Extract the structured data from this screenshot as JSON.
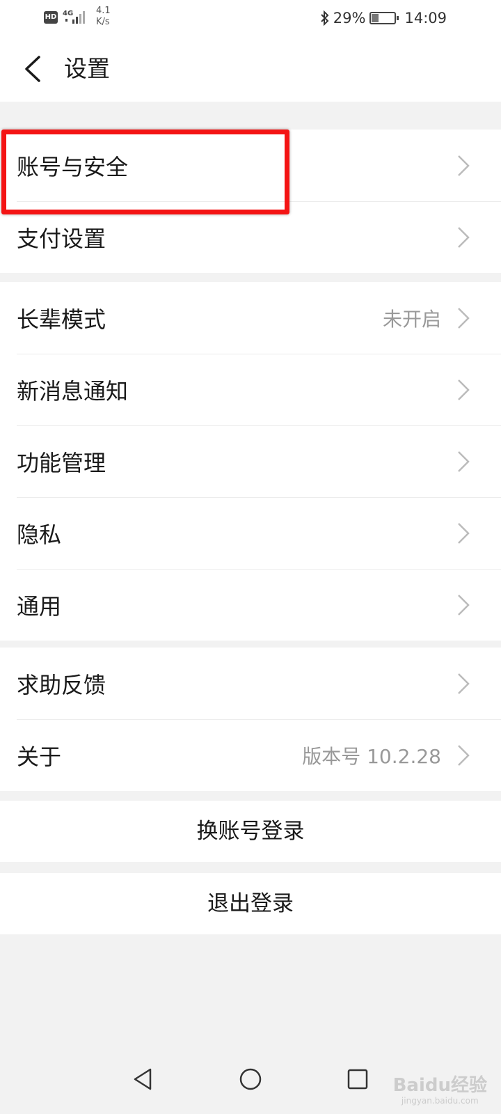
{
  "status_bar": {
    "hd_badge": "HD",
    "network": "4G",
    "speed_value": "4.1",
    "speed_unit": "K/s",
    "battery_percent": "29%",
    "battery_level": 0.29,
    "time": "14:09",
    "icons": [
      "bluetooth-icon",
      "battery-charging-icon",
      "signal-icon"
    ]
  },
  "header": {
    "title": "设置",
    "back_icon": "chevron-left-icon"
  },
  "groups": [
    {
      "items": [
        {
          "label": "账号与安全",
          "value": ""
        },
        {
          "label": "支付设置",
          "value": ""
        }
      ]
    },
    {
      "items": [
        {
          "label": "长辈模式",
          "value": "未开启"
        },
        {
          "label": "新消息通知",
          "value": ""
        },
        {
          "label": "功能管理",
          "value": ""
        },
        {
          "label": "隐私",
          "value": ""
        },
        {
          "label": "通用",
          "value": ""
        }
      ]
    },
    {
      "items": [
        {
          "label": "求助反馈",
          "value": ""
        },
        {
          "label": "关于",
          "value": "版本号 10.2.28"
        }
      ]
    }
  ],
  "actions": {
    "switch_account": "换账号登录",
    "logout": "退出登录"
  },
  "nav_bar": {
    "icons": [
      "triangle-back-icon",
      "circle-home-icon",
      "square-recent-icon"
    ]
  },
  "watermark": {
    "logo_text": "Baidu经验",
    "sub_text": "jingyan.baidu.com"
  },
  "colors": {
    "background": "#f2f2f2",
    "card": "#ffffff",
    "highlight_border": "#f41414",
    "secondary_text": "#999999"
  }
}
